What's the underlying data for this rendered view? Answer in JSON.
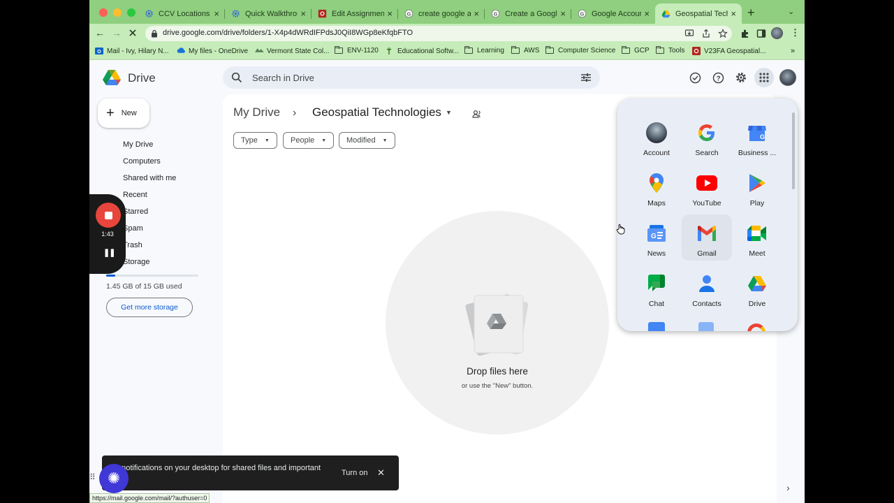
{
  "browser": {
    "tabs": [
      {
        "label": "CCV Locations Di",
        "favicon": "gear-icon",
        "active": false
      },
      {
        "label": "Quick Walkthroug",
        "favicon": "gear-icon",
        "active": false
      },
      {
        "label": "Edit Assignment",
        "favicon": "canvas-icon",
        "active": false
      },
      {
        "label": "create google acc",
        "favicon": "google-icon",
        "active": false
      },
      {
        "label": "Create a Google A",
        "favicon": "google-icon",
        "active": false
      },
      {
        "label": "Google Account",
        "favicon": "google-icon",
        "active": false
      },
      {
        "label": "Geospatial Techn",
        "favicon": "drive-icon",
        "active": true
      }
    ],
    "url": "drive.google.com/drive/folders/1-X4p4dWRdIFPdsJ0QiI8WGp8eKfqbFTO",
    "bookmarks": [
      {
        "label": "Mail - Ivy, Hilary N...",
        "icon": "outlook-icon"
      },
      {
        "label": "My files - OneDrive",
        "icon": "onedrive-icon"
      },
      {
        "label": "Vermont State Col...",
        "icon": "vsc-icon"
      },
      {
        "label": "ENV-1120",
        "icon": "folder-icon"
      },
      {
        "label": "Educational Softw...",
        "icon": "edu-icon"
      },
      {
        "label": "Learning",
        "icon": "folder-icon"
      },
      {
        "label": "AWS",
        "icon": "folder-icon"
      },
      {
        "label": "Computer Science",
        "icon": "folder-icon"
      },
      {
        "label": "GCP",
        "icon": "folder-icon"
      },
      {
        "label": "Tools",
        "icon": "folder-icon"
      },
      {
        "label": "V23FA Geospatial...",
        "icon": "canvas-icon"
      }
    ],
    "bookmarks_more": "»",
    "status_url": "https://mail.google.com/mail/?authuser=0"
  },
  "drive": {
    "app_title": "Drive",
    "search_placeholder": "Search in Drive",
    "new_label": "New",
    "nav": [
      {
        "label": "My Drive",
        "icon": "my-drive-icon"
      },
      {
        "label": "Computers",
        "icon": "computer-icon"
      },
      {
        "label": "Shared with me",
        "icon": "shared-icon"
      },
      {
        "label": "Recent",
        "icon": "clock-icon"
      },
      {
        "label": "Starred",
        "icon": "star-icon"
      },
      {
        "label": "Spam",
        "icon": "spam-icon"
      },
      {
        "label": "Trash",
        "icon": "trash-icon"
      },
      {
        "label": "Storage",
        "icon": "cloud-icon"
      }
    ],
    "storage_used_fraction": 0.097,
    "storage_text": "1.45 GB of 15 GB used",
    "get_storage_label": "Get more storage",
    "breadcrumb_root": "My Drive",
    "breadcrumb_sep": "›",
    "folder_title": "Geospatial Technologies",
    "filters": [
      "Type",
      "People",
      "Modified"
    ],
    "drop_title": "Drop files here",
    "drop_subtitle": "or use the \"New\" button."
  },
  "recorder": {
    "time": "1:43",
    "pause_glyph": "❚❚"
  },
  "apps": [
    {
      "label": "Account",
      "icon": "account-icon"
    },
    {
      "label": "Search",
      "icon": "google-icon"
    },
    {
      "label": "Business ...",
      "icon": "business-icon"
    },
    {
      "label": "Maps",
      "icon": "maps-icon"
    },
    {
      "label": "YouTube",
      "icon": "youtube-icon"
    },
    {
      "label": "Play",
      "icon": "play-icon"
    },
    {
      "label": "News",
      "icon": "news-icon"
    },
    {
      "label": "Gmail",
      "icon": "gmail-icon"
    },
    {
      "label": "Meet",
      "icon": "meet-icon"
    },
    {
      "label": "Chat",
      "icon": "chat-icon"
    },
    {
      "label": "Contacts",
      "icon": "contacts-icon"
    },
    {
      "label": "Drive",
      "icon": "drive-icon"
    }
  ],
  "toast": {
    "message": "t notifications on your desktop for shared files and important its",
    "button": "Turn on",
    "close": "✕"
  },
  "colors": {
    "tab_strip": "#8fcf7f",
    "toolbar": "#c6ecb9",
    "drive_bg": "#f7f9fc",
    "accent_blue": "#0b57d0",
    "recorder_red": "#e8453c",
    "toast_bg": "#1f1f1f"
  }
}
